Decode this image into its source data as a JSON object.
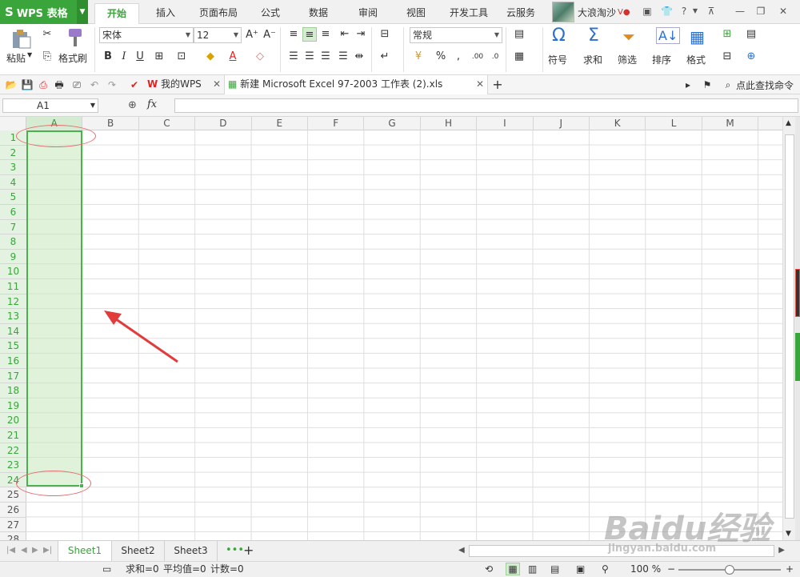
{
  "app": {
    "name": "WPS 表格",
    "logo": "S"
  },
  "ribbon_tabs": [
    "开始",
    "插入",
    "页面布局",
    "公式",
    "数据",
    "审阅",
    "视图",
    "开发工具",
    "云服务"
  ],
  "active_tab": "开始",
  "user": {
    "name": "大浪淘沙"
  },
  "ribbon": {
    "paste": "粘贴",
    "format_painter": "格式刷",
    "font_name": "宋体",
    "font_size": "12",
    "number_format": "常规",
    "symbol": "符号",
    "sum": "求和",
    "filter": "筛选",
    "sort": "排序",
    "format": "格式"
  },
  "doc_tabs": [
    {
      "label": "我的WPS",
      "active": false
    },
    {
      "label": "新建 Microsoft Excel 97-2003 工作表 (2).xls",
      "active": true
    }
  ],
  "search_cmd": "点此查找命令",
  "formula_bar": {
    "name_box": "A1",
    "fx": "fx",
    "value": ""
  },
  "columns": [
    "A",
    "B",
    "C",
    "D",
    "E",
    "F",
    "G",
    "H",
    "I",
    "J",
    "K",
    "L",
    "M"
  ],
  "rows": [
    "1",
    "2",
    "3",
    "4",
    "5",
    "6",
    "7",
    "8",
    "9",
    "10",
    "11",
    "12",
    "13",
    "14",
    "15",
    "16",
    "17",
    "18",
    "19",
    "20",
    "21",
    "22",
    "23",
    "24",
    "25",
    "26",
    "27",
    "28"
  ],
  "selection": {
    "column": "A",
    "from_row": 1,
    "to_row": 24
  },
  "sheets": [
    "Sheet1",
    "Sheet2",
    "Sheet3"
  ],
  "active_sheet": "Sheet1",
  "status": {
    "sum": "求和=0",
    "avg": "平均值=0",
    "count": "计数=0",
    "zoom": "100 %"
  },
  "watermark": {
    "brand": "Baidu经验",
    "url": "jingyan.baidu.com"
  },
  "colors": {
    "accent": "#3aa53a",
    "selection_fill": "#e2f3dd",
    "annotation": "#e56d6d"
  }
}
